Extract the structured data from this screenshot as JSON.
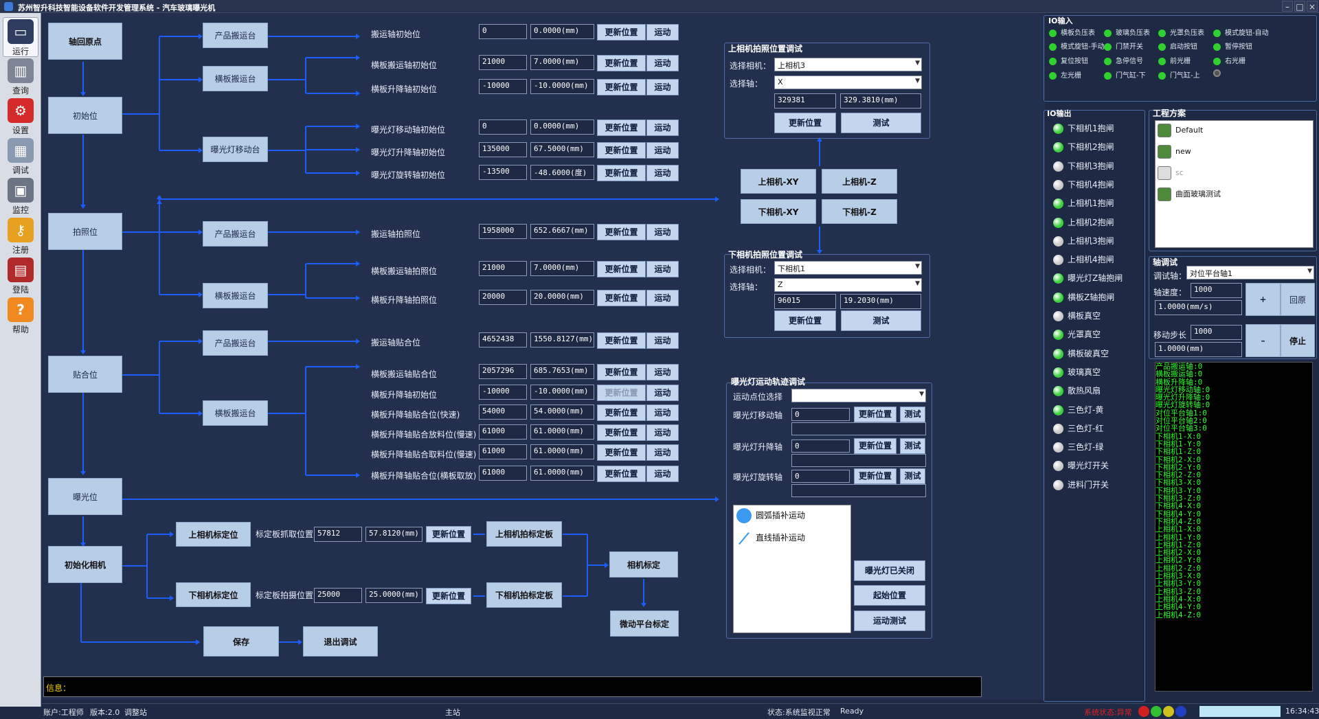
{
  "window": {
    "title": "苏州智升科技智能设备软件开发管理系统 - 汽车玻璃曝光机",
    "controls": [
      "–",
      "□",
      "×"
    ]
  },
  "sidebar": [
    {
      "label": "运行",
      "icon": "monitor-icon",
      "color": "#2f3e60",
      "active": true
    },
    {
      "label": "查询",
      "icon": "bar-chart-icon",
      "color": "#7d8596"
    },
    {
      "label": "设置",
      "icon": "gear-icon",
      "color": "#d42a2a"
    },
    {
      "label": "调试",
      "icon": "calculator-icon",
      "color": "#8a9ab0"
    },
    {
      "label": "监控",
      "icon": "monitor-small-icon",
      "color": "#6a7484"
    },
    {
      "label": "注册",
      "icon": "key-icon",
      "color": "#e8a020"
    },
    {
      "label": "登陆",
      "icon": "login-icon",
      "color": "#b02a2a"
    },
    {
      "label": "帮助",
      "icon": "help-icon",
      "color": "#f08a20"
    }
  ],
  "flow": {
    "stages": [
      "轴回原点",
      "初始位",
      "拍照位",
      "贴合位",
      "曝光位",
      "初始化相机"
    ],
    "stations": [
      "产品搬运台",
      "横板搬运台",
      "曝光灯移动台",
      "产品搬运台",
      "横板搬运台",
      "产品搬运台",
      "横板搬运台"
    ],
    "cal": {
      "upper": "上相机标定位",
      "lower": "下相机标定位",
      "upper_lbl": "标定板抓取位置",
      "lower_lbl": "标定板拍摄位置",
      "upper_val": "57812",
      "upper_mm": "57.8120(mm)",
      "lower_val": "25000",
      "lower_mm": "25.0000(mm)",
      "upper_shot": "上相机拍标定板",
      "lower_shot": "下相机拍标定板",
      "camcal": "相机标定",
      "platcal": "微动平台标定",
      "save": "保存",
      "exit": "退出调试"
    }
  },
  "rows": [
    {
      "label": "搬运轴初始位",
      "v": "0",
      "mm": "0.0000(mm)"
    },
    {
      "label": "横板搬运轴初始位",
      "v": "21000",
      "mm": "7.0000(mm)"
    },
    {
      "label": "横板升降轴初始位",
      "v": "-10000",
      "mm": "-10.0000(mm)"
    },
    {
      "label": "曝光灯移动轴初始位",
      "v": "0",
      "mm": "0.0000(mm)"
    },
    {
      "label": "曝光灯升降轴初始位",
      "v": "135000",
      "mm": "67.5000(mm)"
    },
    {
      "label": "曝光灯旋转轴初始位",
      "v": "-13500",
      "mm": "-48.6000(度)"
    },
    {
      "label": "搬运轴拍照位",
      "v": "1958000",
      "mm": "652.6667(mm)"
    },
    {
      "label": "横板搬运轴拍照位",
      "v": "21000",
      "mm": "7.0000(mm)"
    },
    {
      "label": "横板升降轴拍照位",
      "v": "20000",
      "mm": "20.0000(mm)"
    },
    {
      "label": "搬运轴贴合位",
      "v": "4652438",
      "mm": "1550.8127(mm)"
    },
    {
      "label": "横板搬运轴贴合位",
      "v": "2057296",
      "mm": "685.7653(mm)"
    },
    {
      "label": "横板升降轴初始位",
      "v": "-10000",
      "mm": "-10.0000(mm)",
      "dis": true
    },
    {
      "label": "横板升降轴贴合位(快速)",
      "v": "54000",
      "mm": "54.0000(mm)"
    },
    {
      "label": "横板升降轴贴合放料位(慢速)",
      "v": "61000",
      "mm": "61.0000(mm)"
    },
    {
      "label": "横板升降轴贴合取料位(慢速)",
      "v": "61000",
      "mm": "61.0000(mm)"
    },
    {
      "label": "横板升降轴贴合位(横板取放)",
      "v": "61000",
      "mm": "61.0000(mm)"
    }
  ],
  "btn": {
    "update": "更新位置",
    "move": "运动",
    "test": "测试"
  },
  "upper_cam": {
    "title": "上相机拍照位置调试",
    "cam_lbl": "选择相机：",
    "cam": "上相机3",
    "axis_lbl": "选择轴：",
    "axis": "X",
    "v": "329381",
    "mm": "329.3810(mm)"
  },
  "cam_btns": [
    "上相机-XY",
    "上相机-Z",
    "下相机-XY",
    "下相机-Z"
  ],
  "lower_cam": {
    "title": "下相机拍照位置调试",
    "cam_lbl": "选择相机：",
    "cam": "下相机1",
    "axis_lbl": "选择轴：",
    "axis": "Z",
    "v": "96015",
    "mm": "19.2030(mm)"
  },
  "expo": {
    "title": "曝光灯运动轨迹调试",
    "pt_lbl": "运动点位选择",
    "axes": [
      {
        "label": "曝光灯移动轴",
        "v": "0"
      },
      {
        "label": "曝光灯升降轴",
        "v": "0"
      },
      {
        "label": "曝光灯旋转轴",
        "v": "0"
      }
    ],
    "arc": "圆弧插补运动",
    "line": "直线插补运动",
    "closed": "曝光灯已关闭",
    "start": "起始位置",
    "mtest": "运动测试"
  },
  "io_in": {
    "title": "IO输入",
    "items": [
      {
        "t": "横板负压表",
        "c": "#2ed12e"
      },
      {
        "t": "玻璃负压表",
        "c": "#2ed12e"
      },
      {
        "t": "光罩负压表",
        "c": "#2ed12e"
      },
      {
        "t": "模式旋钮-自动",
        "c": "#2ed12e"
      },
      {
        "t": "模式旋钮-手动",
        "c": "#2ed12e"
      },
      {
        "t": "门禁开关",
        "c": "#2ed12e"
      },
      {
        "t": "启动按钮",
        "c": "#2ed12e"
      },
      {
        "t": "暂停按钮",
        "c": "#2ed12e"
      },
      {
        "t": "复位按钮",
        "c": "#2ed12e"
      },
      {
        "t": "急停信号",
        "c": "#2ed12e"
      },
      {
        "t": "前光栅",
        "c": "#2ed12e"
      },
      {
        "t": "右光栅",
        "c": "#2ed12e"
      },
      {
        "t": "左光栅",
        "c": "#2ed12e"
      },
      {
        "t": "门气缸-下",
        "c": "#2ed12e"
      },
      {
        "t": "门气缸-上",
        "c": "#2ed12e"
      },
      {
        "t": "",
        "c": "#555"
      }
    ]
  },
  "io_out": {
    "title": "IO输出",
    "items": [
      {
        "t": "下相机1抱闸",
        "c": "#3bd13b"
      },
      {
        "t": "下相机2抱闸",
        "c": "#3bd13b"
      },
      {
        "t": "下相机3抱闸",
        "c": "#c8c8c8"
      },
      {
        "t": "下相机4抱闸",
        "c": "#c8c8c8"
      },
      {
        "t": "上相机1抱闸",
        "c": "#3bd13b"
      },
      {
        "t": "上相机2抱闸",
        "c": "#3bd13b"
      },
      {
        "t": "上相机3抱闸",
        "c": "#c8c8c8"
      },
      {
        "t": "上相机4抱闸",
        "c": "#c8c8c8"
      },
      {
        "t": "曝光灯Z轴抱闸",
        "c": "#3bd13b"
      },
      {
        "t": "横板Z轴抱闸",
        "c": "#3bd13b"
      },
      {
        "t": "横板真空",
        "c": "#c8c8c8"
      },
      {
        "t": "光罩真空",
        "c": "#3bd13b"
      },
      {
        "t": "横板破真空",
        "c": "#3bd13b"
      },
      {
        "t": "玻璃真空",
        "c": "#3bd13b"
      },
      {
        "t": "散热风扇",
        "c": "#3bd13b"
      },
      {
        "t": "三色灯-黄",
        "c": "#3bd13b"
      },
      {
        "t": "三色灯-红",
        "c": "#c8c8c8"
      },
      {
        "t": "三色灯-绿",
        "c": "#c8c8c8"
      },
      {
        "t": "曝光灯开关",
        "c": "#c8c8c8"
      },
      {
        "t": "进料门开关",
        "c": "#c8c8c8"
      }
    ]
  },
  "project": {
    "title": "工程方案",
    "items": [
      {
        "t": "Default",
        "on": true
      },
      {
        "t": "new",
        "on": true
      },
      {
        "t": "sc",
        "on": false
      },
      {
        "t": "曲面玻璃测试",
        "on": true
      }
    ]
  },
  "axis_debug": {
    "title": "轴调试",
    "axis_lbl": "调试轴：",
    "axis": "对位平台轴1",
    "speed_lbl": "轴速度：",
    "speed": "1000",
    "speed_unit": "1.0000(mm/s)",
    "step_lbl": "移动步长",
    "step": "1000",
    "step_unit": "1.0000(mm)",
    "plus": "+",
    "minus": "–",
    "home": "回原",
    "stop": "停止"
  },
  "console": [
    "产品搬运轴:0",
    "横板搬运轴:0",
    "横板升降轴:0",
    "曝光灯移动轴:0",
    "曝光灯升降轴:0",
    "曝光灯旋转轴:0",
    "对位平台轴1:0",
    "对位平台轴2:0",
    "对位平台轴3:0",
    "下相机1-X:0",
    "下相机1-Y:0",
    "下相机1-Z:0",
    "下相机2-X:0",
    "下相机2-Y:0",
    "下相机2-Z:0",
    "下相机3-X:0",
    "下相机3-Y:0",
    "下相机3-Z:0",
    "下相机4-X:0",
    "下相机4-Y:0",
    "下相机4-Z:0",
    "上相机1-X:0",
    "上相机1-Y:0",
    "上相机1-Z:0",
    "上相机2-X:0",
    "上相机2-Y:0",
    "上相机2-Z:0",
    "上相机3-X:0",
    "上相机3-Y:0",
    "上相机3-Z:0",
    "上相机4-X:0",
    "上相机4-Y:0",
    "上相机4-Z:0"
  ],
  "info": {
    "label": "信息："
  },
  "status": {
    "account": "账户:工程师",
    "version": "版本:2.0",
    "station": "调整站",
    "main": "主站",
    "state": "状态:系统监视正常",
    "ready": "Ready",
    "sys": "系统状态:异常",
    "time": "16:34:43"
  }
}
